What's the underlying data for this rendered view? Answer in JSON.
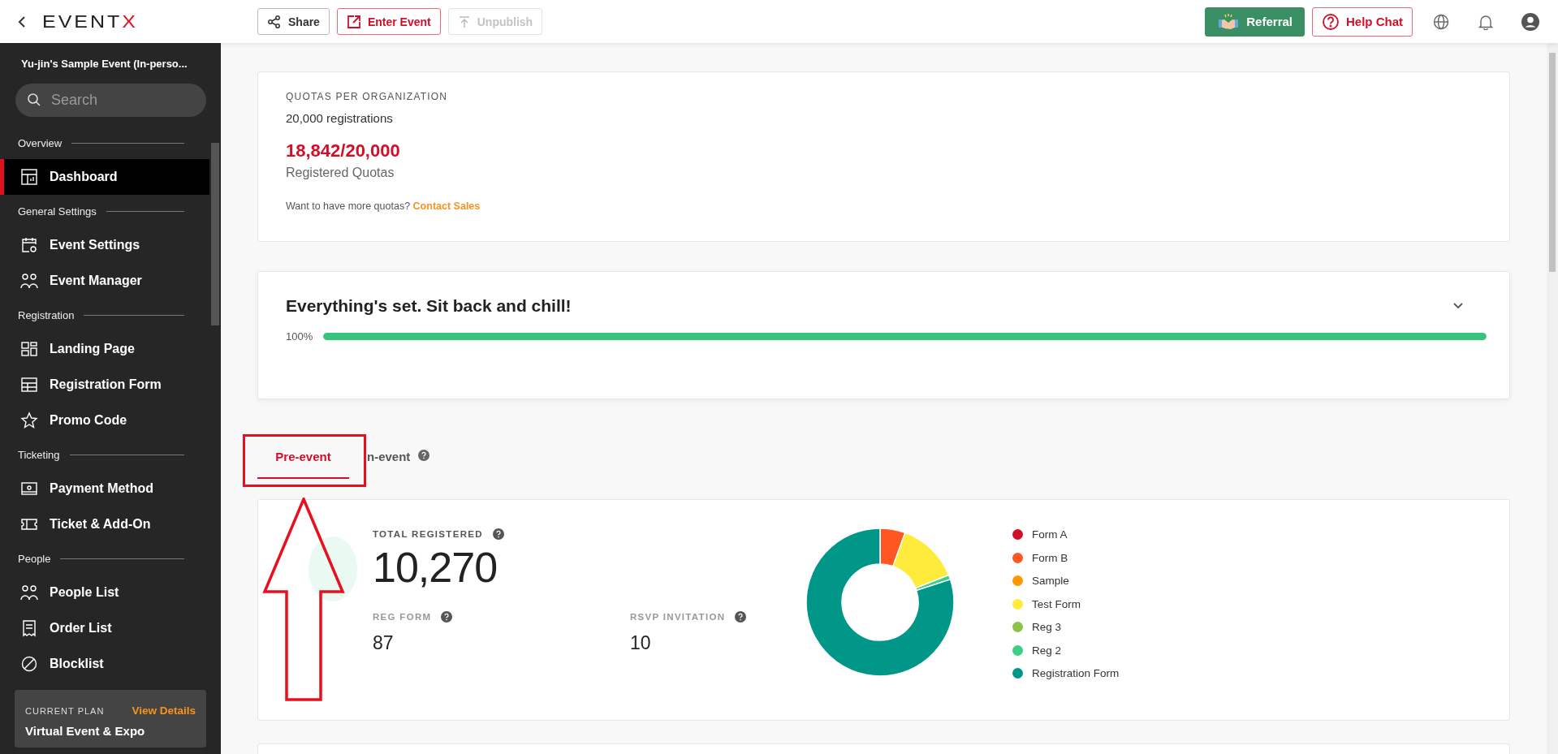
{
  "header": {
    "logo": "EVENTX",
    "actions": [
      {
        "kind": "share",
        "label": "Share",
        "disabled": false
      },
      {
        "kind": "enter",
        "label": "Enter Event",
        "disabled": false
      },
      {
        "kind": "unpublish",
        "label": "Unpublish",
        "disabled": true
      }
    ],
    "right_actions": [
      {
        "kind": "referral",
        "label": "Referral"
      },
      {
        "kind": "help",
        "label": "Help Chat"
      }
    ]
  },
  "sidebar": {
    "event_title": "Yu-jin's Sample Event (In-perso...",
    "search": {
      "placeholder": "Search"
    },
    "sections": [
      {
        "title": "Overview",
        "items": [
          {
            "label": "Dashboard",
            "selected": true
          }
        ]
      },
      {
        "title": "General Settings",
        "items": [
          {
            "label": "Event Settings",
            "selected": false
          },
          {
            "label": "Event Manager",
            "selected": false
          }
        ]
      },
      {
        "title": "Registration",
        "items": [
          {
            "label": "Landing Page",
            "selected": false
          },
          {
            "label": "Registration Form",
            "selected": false
          },
          {
            "label": "Promo Code",
            "selected": false
          }
        ]
      },
      {
        "title": "Ticketing",
        "items": [
          {
            "label": "Payment Method",
            "selected": false
          },
          {
            "label": "Ticket & Add-On",
            "selected": false
          }
        ]
      },
      {
        "title": "People",
        "items": [
          {
            "label": "People List",
            "selected": false
          },
          {
            "label": "Order List",
            "selected": false
          },
          {
            "label": "Blocklist",
            "selected": false
          }
        ]
      }
    ],
    "plan": {
      "label": "CURRENT PLAN",
      "link": "View Details",
      "name": "Virtual Event & Expo"
    }
  },
  "quota": {
    "title": "QUOTAS PER ORGANIZATION",
    "limit": "20,000 registrations",
    "usage": "18,842/20,000",
    "usage_label": "Registered Quotas",
    "note": "Want to have more quotas?",
    "link": "Contact Sales"
  },
  "progress": {
    "title": "Everything's set. Sit back and chill!",
    "reading": "100%",
    "level": 1
  },
  "tabs": [
    {
      "label": "Pre-event",
      "selected": true,
      "help": false
    },
    {
      "label": "n-event",
      "selected": false,
      "help": true
    }
  ],
  "stats": {
    "total_label": "TOTAL REGISTERED",
    "total": "10,270",
    "metrics": [
      {
        "label": "REG FORM",
        "value": "87"
      },
      {
        "label": "RSVP INVITATION",
        "value": "10"
      }
    ],
    "legend": [
      {
        "label": "Form A",
        "color": "#d0102a"
      },
      {
        "label": "Form B",
        "color": "#ff5722"
      },
      {
        "label": "Sample",
        "color": "#ff9800"
      },
      {
        "label": "Test Form",
        "color": "#ffeb3b"
      },
      {
        "label": "Reg 3",
        "color": "#8bc34a"
      },
      {
        "label": "Reg 2",
        "color": "#3ccf85"
      },
      {
        "label": "Registration Form",
        "color": "#009688"
      }
    ]
  }
}
